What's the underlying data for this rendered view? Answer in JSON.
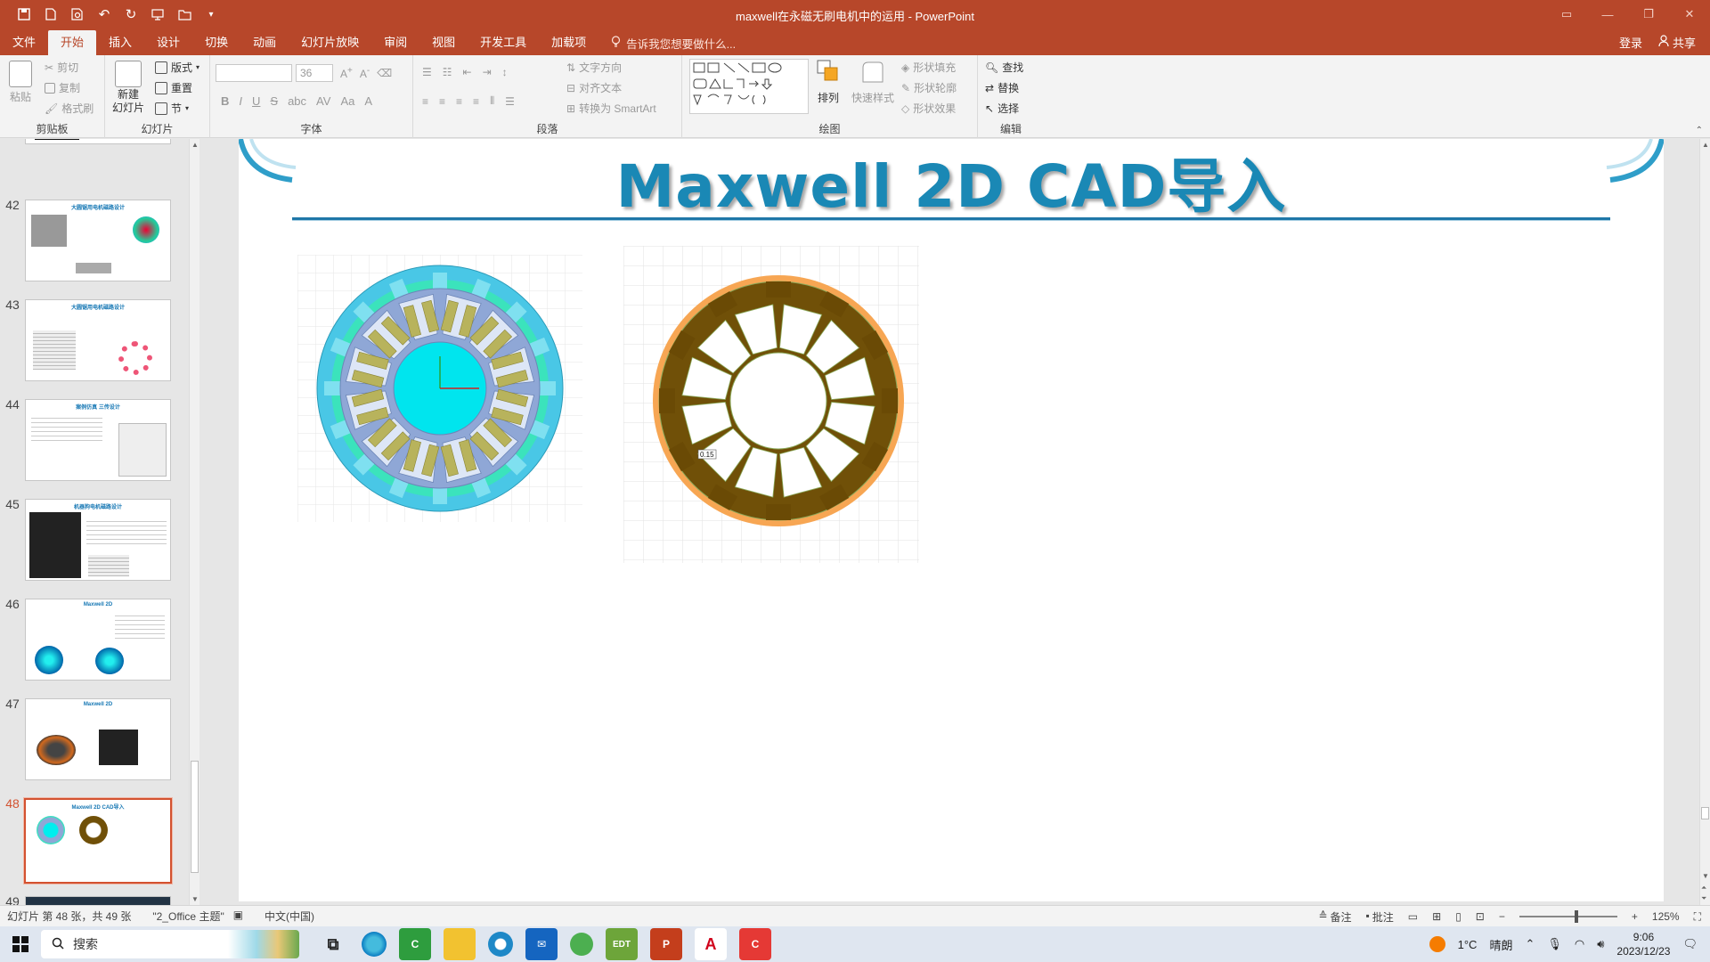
{
  "window": {
    "title": "maxwell在永磁无刷电机中的运用 - PowerPoint"
  },
  "tabs": [
    "文件",
    "开始",
    "插入",
    "设计",
    "切换",
    "动画",
    "幻灯片放映",
    "审阅",
    "视图",
    "开发工具",
    "加载项"
  ],
  "active_tab": "开始",
  "tell_me": "告诉我您想要做什么...",
  "account": {
    "login": "登录",
    "share": "共享"
  },
  "ribbon": {
    "clipboard": {
      "label": "剪贴板",
      "paste": "粘贴",
      "cut": "剪切",
      "copy": "复制",
      "format_painter": "格式刷"
    },
    "slides": {
      "label": "幻灯片",
      "new_slide": "新建\n幻灯片",
      "new_slide_line1": "新建",
      "new_slide_line2": "幻灯片",
      "layout": "版式",
      "reset": "重置",
      "section": "节"
    },
    "font": {
      "label": "字体",
      "font_name": "",
      "font_size": "36"
    },
    "paragraph": {
      "label": "段落",
      "text_direction": "文字方向",
      "align_text": "对齐文本",
      "smartart": "转换为 SmartArt"
    },
    "drawing": {
      "label": "绘图",
      "arrange": "排列",
      "quick_styles": "快速样式",
      "shape_fill": "形状填充",
      "shape_outline": "形状轮廓",
      "shape_effects": "形状效果"
    },
    "editing": {
      "label": "编辑",
      "find": "查找",
      "replace": "替换",
      "select": "选择"
    }
  },
  "thumbnails": [
    {
      "num": "42",
      "title": "大圆锯用电机磁路设计"
    },
    {
      "num": "43",
      "title": "大圆锯用电机磁路设计"
    },
    {
      "num": "44",
      "title": "案例仿真 三传设计"
    },
    {
      "num": "45",
      "title": "机器狗电机磁路设计"
    },
    {
      "num": "46",
      "title": "Maxwell 2D"
    },
    {
      "num": "47",
      "title": "Maxwell 2D"
    },
    {
      "num": "48",
      "title": "Maxwell 2D CAD导入"
    },
    {
      "num": "49",
      "title": ""
    }
  ],
  "selected_slide": "48",
  "slide": {
    "title": "Maxwell 2D CAD导入",
    "dimension_label": "0.15",
    "colors": {
      "rotor_fill": "#00e5ee",
      "stator_ring": "#49c7e6",
      "magnet_ring": "#3be3bc",
      "slot_fill": "#8fa7d6",
      "coil_fill": "#b8b35c",
      "lam_fill": "#705008",
      "lam_outer": "#f7a653"
    }
  },
  "status": {
    "slide_info": "幻灯片 第 48 张，共 49 张",
    "theme": "\"2_Office 主题\"",
    "language": "中文(中国)",
    "notes": "备注",
    "comments": "批注",
    "zoom": "125%"
  },
  "taskbar": {
    "search_placeholder": "搜索",
    "weather_temp": "1°C",
    "weather_text": "晴朗",
    "time": "9:06",
    "date": "2023/12/23"
  }
}
